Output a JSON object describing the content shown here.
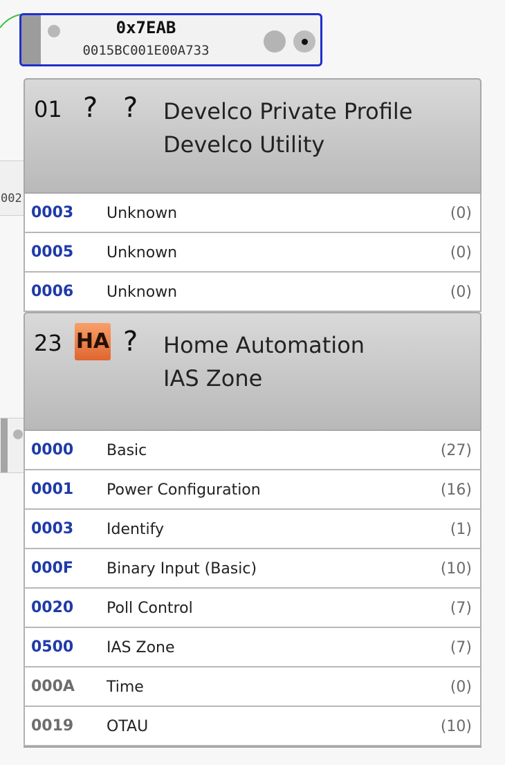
{
  "colors": {
    "selection_border": "#1f2ecf",
    "cluster_id_active": "#1f3ba8",
    "cluster_id_inactive": "#6d6d6d",
    "ha_badge": "#e87a3f",
    "edge_line": "#3ac23a"
  },
  "background": {
    "neighbor_fragment": "002"
  },
  "node": {
    "nwk_address": "0x7EAB",
    "ext_address": "0015BC001E00A733"
  },
  "endpoints": [
    {
      "id": "01",
      "badge": "?",
      "profile_icon": "?",
      "profile_name": "Develco Private Profile",
      "device_name": "Develco Utility",
      "clusters": [
        {
          "id": "0003",
          "name": "Unknown",
          "count": "(0)",
          "active": true
        },
        {
          "id": "0005",
          "name": "Unknown",
          "count": "(0)",
          "active": true
        },
        {
          "id": "0006",
          "name": "Unknown",
          "count": "(0)",
          "active": true
        }
      ]
    },
    {
      "id": "23",
      "badge": "HA",
      "profile_icon": "?",
      "profile_name": "Home Automation",
      "device_name": "IAS Zone",
      "clusters": [
        {
          "id": "0000",
          "name": "Basic",
          "count": "(27)",
          "active": true
        },
        {
          "id": "0001",
          "name": "Power Configuration",
          "count": "(16)",
          "active": true
        },
        {
          "id": "0003",
          "name": "Identify",
          "count": "(1)",
          "active": true
        },
        {
          "id": "000F",
          "name": "Binary Input (Basic)",
          "count": "(10)",
          "active": true
        },
        {
          "id": "0020",
          "name": "Poll Control",
          "count": "(7)",
          "active": true
        },
        {
          "id": "0500",
          "name": "IAS Zone",
          "count": "(7)",
          "active": true
        },
        {
          "id": "000A",
          "name": "Time",
          "count": "(0)",
          "active": false
        },
        {
          "id": "0019",
          "name": "OTAU",
          "count": "(10)",
          "active": false
        }
      ]
    }
  ]
}
